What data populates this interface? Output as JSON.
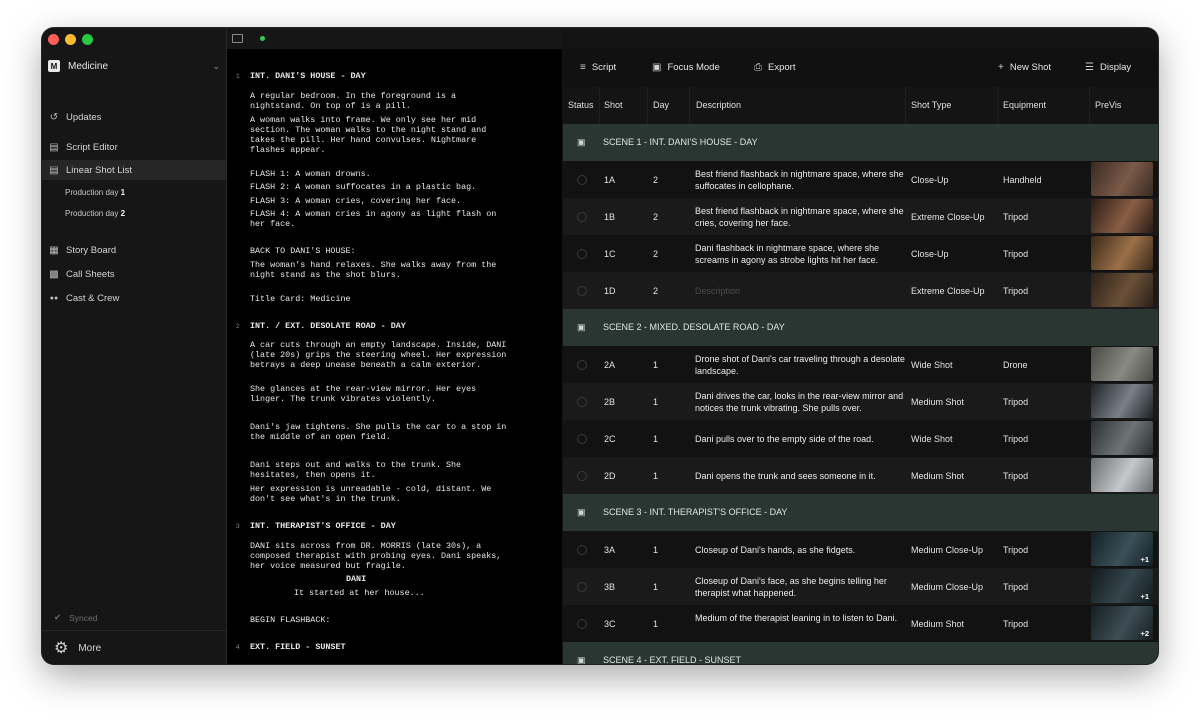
{
  "window": {
    "traffic_colors": [
      "#fe5f57",
      "#febc2e",
      "#28c840"
    ]
  },
  "project": {
    "logo": "M",
    "name": "Medicine"
  },
  "sidebar": {
    "items": [
      {
        "label": "Updates",
        "icon": "history-icon"
      },
      {
        "label": "Script Editor",
        "icon": "document-icon"
      },
      {
        "label": "Linear Shot List",
        "icon": "list-icon"
      },
      {
        "label": "Story Board",
        "icon": "storyboard-icon"
      },
      {
        "label": "Call Sheets",
        "icon": "clipboard-icon"
      },
      {
        "label": "Cast & Crew",
        "icon": "people-icon"
      }
    ],
    "subitems": [
      {
        "prefix": "Production day ",
        "num": "1"
      },
      {
        "prefix": "Production day ",
        "num": "2"
      }
    ],
    "synced": "Synced",
    "more": "More"
  },
  "script": {
    "scene_numbers": [
      "1",
      "2",
      "3",
      "4"
    ],
    "lines": [
      "INT. DANI'S HOUSE - DAY",
      "A regular bedroom. In the foreground is a",
      "nightstand. On top of is a pill.",
      "A woman walks into frame. We only see her mid",
      "section. The woman walks to the night stand and",
      "takes the pill. Her hand convulses. Nightmare",
      "flashes appear.",
      "FLASH 1: A woman drowns.",
      "FLASH 2: A woman suffocates in a plastic bag.",
      "FLASH 3: A woman cries, covering her face.",
      "FLASH 4: A woman cries in agony as light flash on",
      "her face.",
      "BACK TO DANI'S HOUSE:",
      "The woman's hand relaxes. She walks away from the",
      "night stand as the shot blurs.",
      "Title Card: Medicine",
      "INT. / EXT. DESOLATE ROAD - DAY",
      "A car cuts through an empty landscape. Inside, DANI",
      "(late 20s) grips the steering wheel. Her expression",
      "betrays a deep unease beneath a calm exterior.",
      "She glances at the rear-view mirror. Her eyes",
      "linger. The trunk vibrates violently.",
      "Dani's jaw tightens. She pulls the car to a stop in",
      "the middle of an open field.",
      "Dani steps out and walks to the trunk. She",
      "hesitates, then opens it.",
      "Her expression is unreadable - cold, distant. We",
      "don't see what's in the trunk.",
      "INT. THERAPIST'S OFFICE - DAY",
      "DANI sits across from DR. MORRIS (late 30s), a",
      "composed therapist with probing eyes. Dani speaks,",
      "her voice measured but fragile.",
      "DANI",
      "It started at her house...",
      "BEGIN FLASHBACK:",
      "EXT. FIELD - SUNSET"
    ]
  },
  "toolbar": {
    "script": "Script",
    "focus": "Focus Mode",
    "export": "Export",
    "new_shot": "New Shot",
    "display": "Display"
  },
  "columns": [
    "Status",
    "Shot",
    "Day",
    "Description",
    "Shot Type",
    "Equipment",
    "PreVis"
  ],
  "scenes": [
    {
      "title": "SCENE 1 - INT. DANI'S HOUSE - DAY",
      "shots": [
        {
          "shot": "1A",
          "day": "2",
          "description": "Best friend flashback in nightmare space, where she suffocates in cellophane.",
          "type": "Close-Up",
          "equipment": "Handheld",
          "previs_extra": "",
          "thumb": [
            "#3a2a22",
            "#7a5a48"
          ]
        },
        {
          "shot": "1B",
          "day": "2",
          "description": "Best friend flashback in nightmare space, where she cries, covering her face.",
          "type": "Extreme Close-Up",
          "equipment": "Tripod",
          "previs_extra": "",
          "thumb": [
            "#2a1c16",
            "#8a5e44"
          ]
        },
        {
          "shot": "1C",
          "day": "2",
          "description": "Dani flashback in nightmare space, where she screams in agony as strobe lights hit her face.",
          "type": "Close-Up",
          "equipment": "Tripod",
          "previs_extra": "",
          "thumb": [
            "#3a2818",
            "#9c7048"
          ]
        },
        {
          "shot": "1D",
          "day": "2",
          "description": "",
          "placeholder": "Description",
          "type": "Extreme Close-Up",
          "equipment": "Tripod",
          "previs_extra": "",
          "thumb": [
            "#2c2018",
            "#6a5038"
          ]
        }
      ]
    },
    {
      "title": "SCENE 2 - MIXED. DESOLATE ROAD - DAY",
      "shots": [
        {
          "shot": "2A",
          "day": "1",
          "description": "Drone shot of Dani's car traveling through a desolate landscape.",
          "type": "Wide Shot",
          "equipment": "Drone",
          "previs_extra": "",
          "thumb": [
            "#4a4a46",
            "#8a8a84"
          ]
        },
        {
          "shot": "2B",
          "day": "1",
          "description": "Dani drives the car, looks in the rear-view mirror and notices the trunk vibrating. She pulls over.",
          "type": "Medium Shot",
          "equipment": "Tripod",
          "previs_extra": "",
          "thumb": [
            "#1e2226",
            "#7a8088"
          ]
        },
        {
          "shot": "2C",
          "day": "1",
          "description": "Dani pulls over to the empty side of the road.",
          "type": "Wide Shot",
          "equipment": "Tripod",
          "previs_extra": "",
          "thumb": [
            "#2a2e30",
            "#6e7476"
          ]
        },
        {
          "shot": "2D",
          "day": "1",
          "description": "Dani opens the trunk and sees someone in it.",
          "type": "Medium Shot",
          "equipment": "Tripod",
          "previs_extra": "",
          "thumb": [
            "#6a6e70",
            "#c4c8ca"
          ]
        }
      ]
    },
    {
      "title": "SCENE 3 - INT. THERAPIST'S OFFICE - DAY",
      "shots": [
        {
          "shot": "3A",
          "day": "1",
          "description": "Closeup of Dani's hands, as she fidgets.",
          "type": "Medium Close-Up",
          "equipment": "Tripod",
          "previs_extra": "+1",
          "thumb": [
            "#142026",
            "#3a5058"
          ]
        },
        {
          "shot": "3B",
          "day": "1",
          "description": "Closeup of Dani's face, as she begins telling her therapist what happened.",
          "type": "Medium Close-Up",
          "equipment": "Tripod",
          "previs_extra": "+1",
          "thumb": [
            "#121a1e",
            "#34464c"
          ]
        },
        {
          "shot": "3C",
          "day": "1",
          "description": "Medium of the therapist leaning in to listen to Dani.",
          "type": "Medium Shot",
          "equipment": "Tripod",
          "previs_extra": "+2",
          "thumb": [
            "#161e22",
            "#3c4e54"
          ]
        }
      ]
    },
    {
      "title": "SCENE 4 - EXT. FIELD - SUNSET",
      "shots": []
    }
  ]
}
